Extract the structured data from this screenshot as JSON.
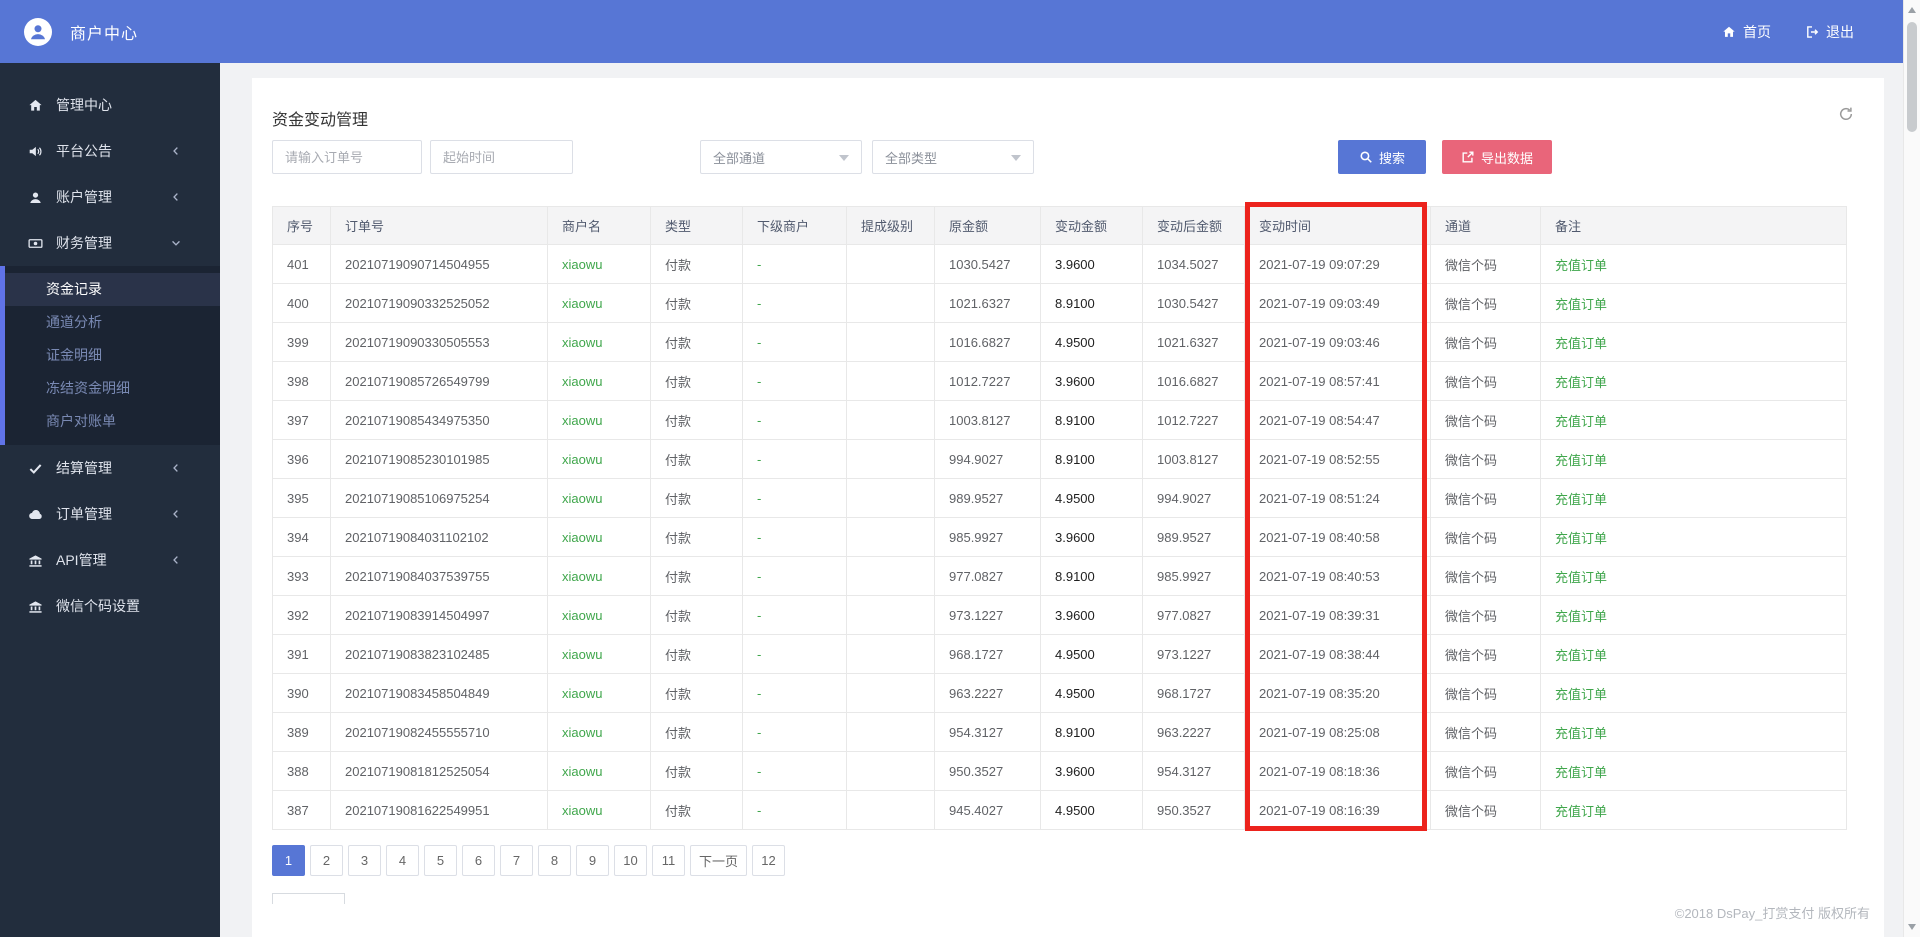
{
  "colors": {
    "accent": "#5776d5",
    "topbar_bg": "#5776d5",
    "sidebar_bg": "#222d3d",
    "sidebar_submenu_bg": "#1b2433",
    "submenu_bar": "#6073e8",
    "export_red": "#e9657a",
    "highlight_red": "#ec231d",
    "green": "#3fa64b"
  },
  "header": {
    "brand": "商户中心",
    "nav": [
      {
        "label": "首页",
        "icon": "home"
      },
      {
        "label": "退出",
        "icon": "logout"
      }
    ]
  },
  "sidebar": {
    "items": [
      {
        "label": "管理中心",
        "icon": "home",
        "chevron": "none"
      },
      {
        "label": "平台公告",
        "icon": "speaker",
        "chevron": "left"
      },
      {
        "label": "账户管理",
        "icon": "user",
        "chevron": "left"
      },
      {
        "label": "财务管理",
        "icon": "money",
        "chevron": "down",
        "expanded": true,
        "children": [
          {
            "label": "资金记录",
            "active": true
          },
          {
            "label": "通道分析",
            "active": false
          },
          {
            "label": "证金明细",
            "active": false
          },
          {
            "label": "冻结资金明细",
            "active": false
          },
          {
            "label": "商户对账单",
            "active": false
          }
        ]
      },
      {
        "label": "结算管理",
        "icon": "check",
        "chevron": "left"
      },
      {
        "label": "订单管理",
        "icon": "cloud",
        "chevron": "left"
      },
      {
        "label": "API管理",
        "icon": "bank",
        "chevron": "left"
      },
      {
        "label": "微信个码设置",
        "icon": "bank",
        "chevron": "none"
      }
    ]
  },
  "main": {
    "title": "资金变动管理",
    "filters": {
      "order_placeholder": "请输入订单号",
      "start_time_placeholder": "起始时间",
      "channel_selected": "全部通道",
      "type_selected": "全部类型",
      "search_label": "搜索",
      "export_label": "导出数据"
    },
    "table": {
      "columns": [
        "序号",
        "订单号",
        "商户名",
        "类型",
        "下级商户",
        "提成级别",
        "原金额",
        "变动金额",
        "变动后金额",
        "变动时间",
        "通道",
        "备注"
      ],
      "rows": [
        [
          "401",
          "20210719090714504955",
          "xiaowu",
          "付款",
          "-",
          "",
          "1030.5427",
          "3.9600",
          "1034.5027",
          "2021-07-19 09:07:29",
          "微信个码",
          "充值订单"
        ],
        [
          "400",
          "20210719090332525052",
          "xiaowu",
          "付款",
          "-",
          "",
          "1021.6327",
          "8.9100",
          "1030.5427",
          "2021-07-19 09:03:49",
          "微信个码",
          "充值订单"
        ],
        [
          "399",
          "20210719090330505553",
          "xiaowu",
          "付款",
          "-",
          "",
          "1016.6827",
          "4.9500",
          "1021.6327",
          "2021-07-19 09:03:46",
          "微信个码",
          "充值订单"
        ],
        [
          "398",
          "20210719085726549799",
          "xiaowu",
          "付款",
          "-",
          "",
          "1012.7227",
          "3.9600",
          "1016.6827",
          "2021-07-19 08:57:41",
          "微信个码",
          "充值订单"
        ],
        [
          "397",
          "20210719085434975350",
          "xiaowu",
          "付款",
          "-",
          "",
          "1003.8127",
          "8.9100",
          "1012.7227",
          "2021-07-19 08:54:47",
          "微信个码",
          "充值订单"
        ],
        [
          "396",
          "20210719085230101985",
          "xiaowu",
          "付款",
          "-",
          "",
          "994.9027",
          "8.9100",
          "1003.8127",
          "2021-07-19 08:52:55",
          "微信个码",
          "充值订单"
        ],
        [
          "395",
          "20210719085106975254",
          "xiaowu",
          "付款",
          "-",
          "",
          "989.9527",
          "4.9500",
          "994.9027",
          "2021-07-19 08:51:24",
          "微信个码",
          "充值订单"
        ],
        [
          "394",
          "20210719084031102102",
          "xiaowu",
          "付款",
          "-",
          "",
          "985.9927",
          "3.9600",
          "989.9527",
          "2021-07-19 08:40:58",
          "微信个码",
          "充值订单"
        ],
        [
          "393",
          "20210719084037539755",
          "xiaowu",
          "付款",
          "-",
          "",
          "977.0827",
          "8.9100",
          "985.9927",
          "2021-07-19 08:40:53",
          "微信个码",
          "充值订单"
        ],
        [
          "392",
          "20210719083914504997",
          "xiaowu",
          "付款",
          "-",
          "",
          "973.1227",
          "3.9600",
          "977.0827",
          "2021-07-19 08:39:31",
          "微信个码",
          "充值订单"
        ],
        [
          "391",
          "20210719083823102485",
          "xiaowu",
          "付款",
          "-",
          "",
          "968.1727",
          "4.9500",
          "973.1227",
          "2021-07-19 08:38:44",
          "微信个码",
          "充值订单"
        ],
        [
          "390",
          "20210719083458504849",
          "xiaowu",
          "付款",
          "-",
          "",
          "963.2227",
          "4.9500",
          "968.1727",
          "2021-07-19 08:35:20",
          "微信个码",
          "充值订单"
        ],
        [
          "389",
          "20210719082455555710",
          "xiaowu",
          "付款",
          "-",
          "",
          "954.3127",
          "8.9100",
          "963.2227",
          "2021-07-19 08:25:08",
          "微信个码",
          "充值订单"
        ],
        [
          "388",
          "20210719081812525054",
          "xiaowu",
          "付款",
          "-",
          "",
          "950.3527",
          "3.9600",
          "954.3127",
          "2021-07-19 08:18:36",
          "微信个码",
          "充值订单"
        ],
        [
          "387",
          "20210719081622549951",
          "xiaowu",
          "付款",
          "-",
          "",
          "945.4027",
          "4.9500",
          "950.3527",
          "2021-07-19 08:16:39",
          "微信个码",
          "充值订单"
        ]
      ]
    },
    "pagination": {
      "active": "1",
      "items": [
        "1",
        "2",
        "3",
        "4",
        "5",
        "6",
        "7",
        "8",
        "9",
        "10",
        "11",
        "下一页",
        "12"
      ]
    },
    "footer": "©2018 DsPay_打赏支付 版权所有"
  }
}
